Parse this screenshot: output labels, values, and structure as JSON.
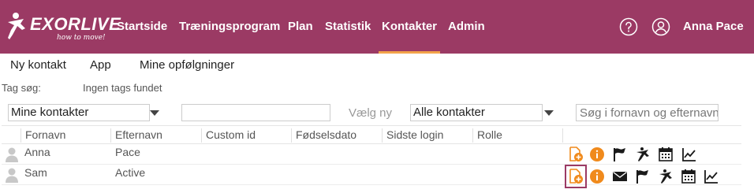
{
  "brand": {
    "name": "EXORLIVE",
    "tagline": "how to move!"
  },
  "nav": {
    "items": [
      "Startside",
      "Træningsprogram",
      "Plan",
      "Statistik",
      "Kontakter",
      "Admin"
    ],
    "active": "Kontakter",
    "active_color": "#f2a34a"
  },
  "header": {
    "bg_color": "#9b3a64",
    "user_name": "Anna Pace",
    "help_icon": "question-circle-icon",
    "user_icon": "user-circle-icon"
  },
  "subnav": {
    "items": [
      "Ny kontakt",
      "App",
      "Mine opfølgninger"
    ]
  },
  "tags": {
    "label": "Tag søg:",
    "value": "Ingen tags fundet"
  },
  "filters": {
    "contacts_select": "Mine kontakter",
    "middle_input_value": "",
    "choose_label": "Vælg ny",
    "all_select": "Alle kontakter",
    "search_placeholder": "Søg i fornavn og efternavn"
  },
  "table": {
    "columns": [
      "Fornavn",
      "Efternavn",
      "Custom id",
      "Fødselsdato",
      "Sidste login",
      "Rolle"
    ],
    "rows": [
      {
        "first": "Anna",
        "last": "Pace",
        "custom_id": "",
        "birthdate": "",
        "last_login": "",
        "role": "",
        "actions": [
          "add-program-icon",
          "info-icon",
          "flag-icon",
          "exercise-icon",
          "calendar-icon",
          "chart-icon"
        ]
      },
      {
        "first": "Sam",
        "last": "Active",
        "custom_id": "",
        "birthdate": "",
        "last_login": "",
        "role": "",
        "actions": [
          "add-program-icon",
          "info-icon",
          "mail-icon",
          "flag-icon",
          "exercise-icon",
          "calendar-icon",
          "chart-icon"
        ]
      }
    ]
  },
  "icon_colors": {
    "orange": "#f08a1c",
    "dark": "#1a1a1a"
  }
}
